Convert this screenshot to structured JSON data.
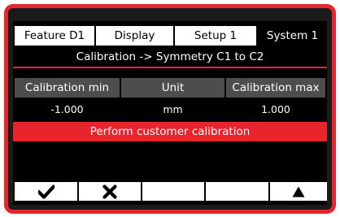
{
  "tabs": [
    {
      "label": "Feature  D1",
      "active": false
    },
    {
      "label": "Display",
      "active": false
    },
    {
      "label": "Setup 1",
      "active": false
    },
    {
      "label": "System 1",
      "active": true
    }
  ],
  "header": {
    "title": "Calibration -> Symmetry C1 to C2"
  },
  "table": {
    "columns": [
      "Calibration min",
      "Unit",
      "Calibration max"
    ],
    "values": [
      "-1.000",
      "mm",
      "1.000"
    ]
  },
  "action": {
    "label": "Perform customer calibration"
  },
  "softkeys": [
    {
      "icon": "checkmark-icon"
    },
    {
      "icon": "cross-icon"
    },
    {
      "icon": ""
    },
    {
      "icon": ""
    },
    {
      "icon": "up-arrow-icon"
    }
  ],
  "colors": {
    "accent": "#e8242c",
    "header_gray": "#4d4d4d",
    "screen": "#000000"
  }
}
